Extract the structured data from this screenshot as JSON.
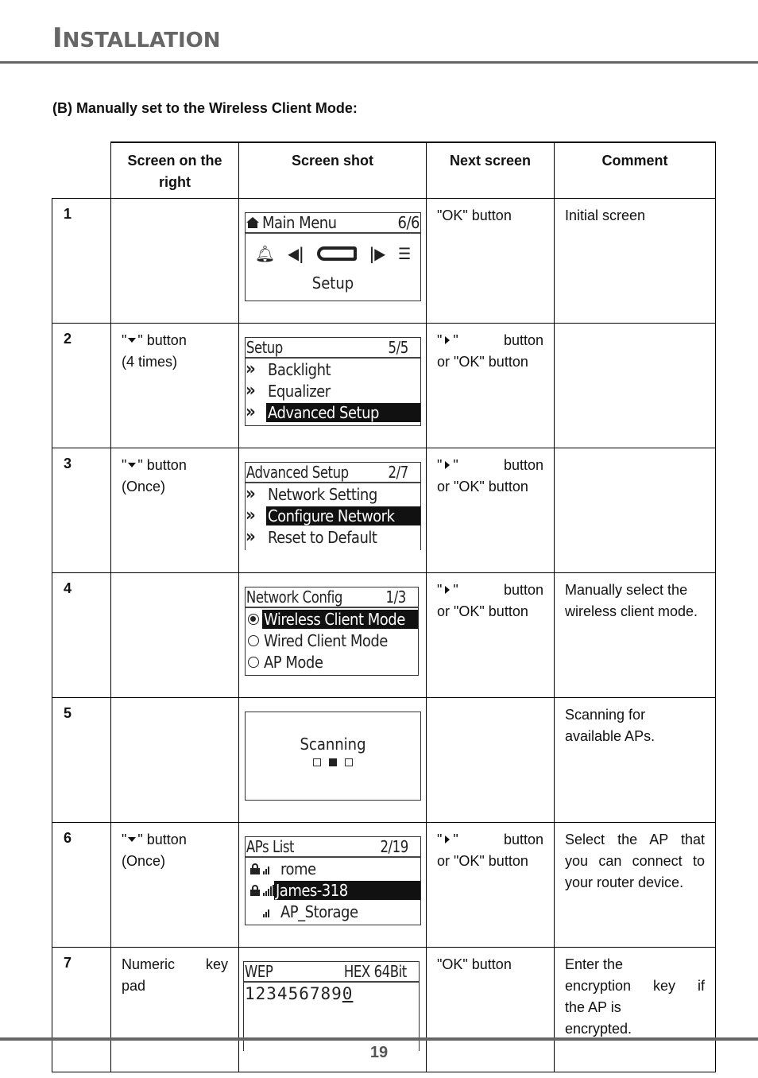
{
  "header": {
    "title_first": "I",
    "title_rest": "NSTALLATION"
  },
  "section_title": "(B) Manually set to the Wireless Client Mode:",
  "table": {
    "headers": [
      "",
      "Screen on the right",
      "Screen shot",
      "Next screen",
      "Comment"
    ],
    "rows": [
      {
        "num": "1",
        "screen_on_right": "",
        "next_screen": "\"OK\" button",
        "comment": "Initial screen"
      },
      {
        "num": "2",
        "screen_on_right": {
          "pre": "\"",
          "icon": "down-arrow",
          "post": "\" button",
          "line2": "(4 times)"
        },
        "next_screen": {
          "pre": "\"",
          "icon": "right-arrow",
          "post": "\"",
          "word": "button",
          "line2": "or \"OK\" button"
        },
        "comment": ""
      },
      {
        "num": "3",
        "screen_on_right": {
          "pre": "\"",
          "icon": "down-arrow",
          "post": "\" button",
          "line2": "(Once)"
        },
        "next_screen": {
          "pre": "\"",
          "icon": "right-arrow",
          "post": "\"",
          "word": "button",
          "line2": "or \"OK\" button"
        },
        "comment": ""
      },
      {
        "num": "4",
        "screen_on_right": "",
        "next_screen": {
          "pre": "\"",
          "icon": "right-arrow",
          "post": "\"",
          "word": "button",
          "line2": "or \"OK\" button"
        },
        "comment": "Manually select the wireless client mode."
      },
      {
        "num": "5",
        "screen_on_right": "",
        "next_screen": "",
        "comment": "Scanning for available APs."
      },
      {
        "num": "6",
        "screen_on_right": {
          "pre": "\"",
          "icon": "down-arrow",
          "post": "\" button",
          "line2": "(Once)"
        },
        "next_screen": {
          "pre": "\"",
          "icon": "right-arrow",
          "post": "\"",
          "word": "button",
          "line2": "or \"OK\" button"
        },
        "comment": "Select the AP that you can connect to your router device."
      },
      {
        "num": "7",
        "screen_on_right": {
          "line1": "Numeric key",
          "line2": "pad"
        },
        "next_screen": "\"OK\" button",
        "comment": "Enter the encryption key if the AP is encrypted."
      }
    ]
  },
  "screens": {
    "main_menu": {
      "title": "Main Menu",
      "page": "6/6",
      "icons": [
        "alarm-bell",
        "prev",
        "setup-wrench",
        "next",
        "list"
      ],
      "label": "Setup"
    },
    "setup": {
      "title": "Setup",
      "page": "5/5",
      "items": [
        "Backlight",
        "Equalizer",
        "Advanced Setup"
      ],
      "selected": 2
    },
    "advanced_setup": {
      "title": "Advanced Setup",
      "page": "2/7",
      "items": [
        "Network Setting",
        "Configure Network",
        "Reset to Default"
      ],
      "selected": 1
    },
    "network_config": {
      "title": "Network Config",
      "page": "1/3",
      "items": [
        "Wireless Client Mode",
        "Wired Client Mode",
        "AP Mode"
      ],
      "checked": 0
    },
    "scanning": {
      "label": "Scanning",
      "dots_active": 2,
      "dots_total": 3
    },
    "aps_list": {
      "title": "APs List",
      "page": "2/19",
      "items": [
        {
          "name": "rome",
          "locked": true,
          "signal_bars": 3
        },
        {
          "name": "James-318",
          "locked": true,
          "signal_bars": 5
        },
        {
          "name": "AP_Storage",
          "locked": false,
          "signal_bars": 3
        }
      ],
      "selected": 1
    },
    "wep": {
      "title": "WEP",
      "mode": "HEX 64Bit",
      "key": "123456789",
      "cursor_char": "0"
    }
  },
  "footer": {
    "page_number": "19"
  }
}
